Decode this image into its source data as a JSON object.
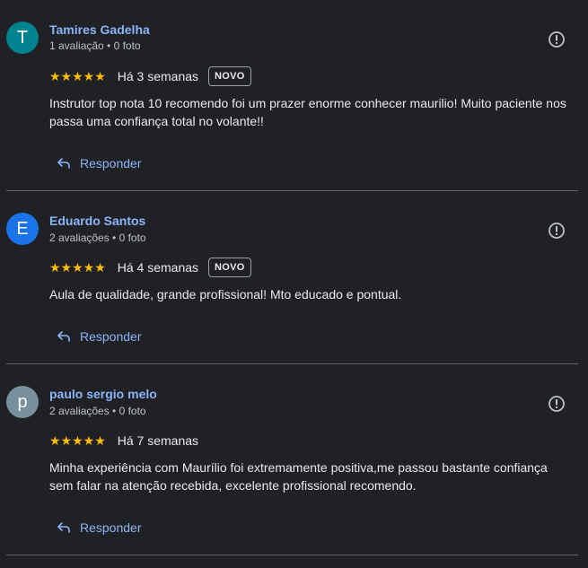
{
  "reviews": [
    {
      "avatar_letter": "T",
      "avatar_color": "#00838f",
      "name": "Tamires Gadelha",
      "meta": "1 avaliação • 0 foto",
      "stars": "★★★★★",
      "rating": 5,
      "time": "Há 3 semanas",
      "badge": "NOVO",
      "text": "Instrutor top nota 10 recomendo foi um prazer enorme conhecer maurilio! Muito paciente nos passa uma confiança total no volante!!",
      "reply_label": "Responder"
    },
    {
      "avatar_letter": "E",
      "avatar_color": "#1a73e8",
      "name": "Eduardo Santos",
      "meta": "2 avaliações • 0 foto",
      "stars": "★★★★★",
      "rating": 5,
      "time": "Há 4 semanas",
      "badge": "NOVO",
      "text": "Aula de qualidade, grande profissional! Mto educado e pontual.",
      "reply_label": "Responder"
    },
    {
      "avatar_letter": "p",
      "avatar_color": "#78909c",
      "name": "paulo sergio melo",
      "meta": "2 avaliações • 0 foto",
      "stars": "★★★★★",
      "rating": 5,
      "time": "Há 7 semanas",
      "badge": "",
      "text": "Minha experiência com Maurílio foi extremamente positiva,me passou bastante confiança sem falar na atenção recebida, excelente profissional recomendo.",
      "reply_label": "Responder"
    }
  ],
  "colors": {
    "background": "#202124",
    "link": "#8ab4f8",
    "star": "#fbbc04",
    "divider": "#5f6368"
  }
}
